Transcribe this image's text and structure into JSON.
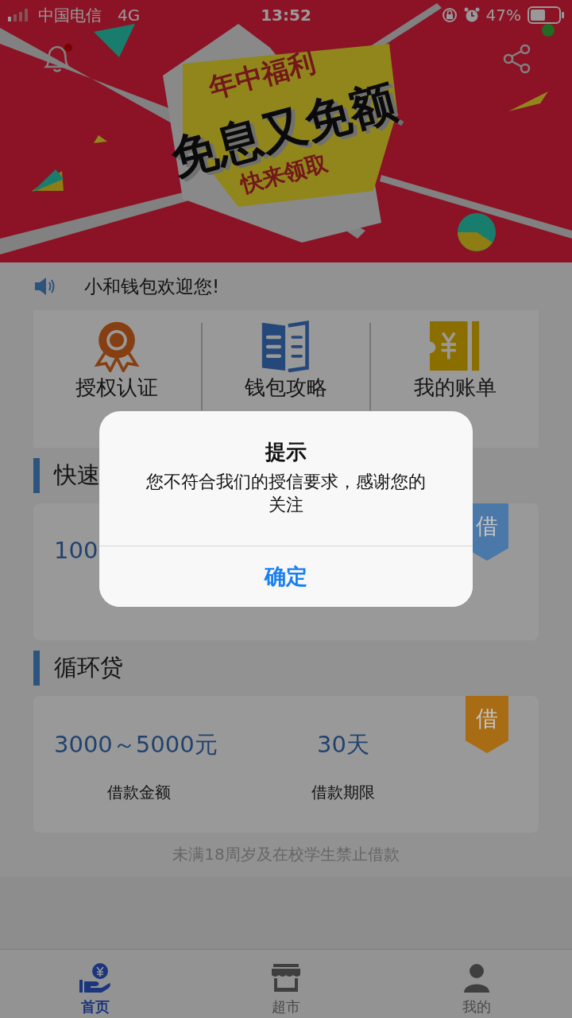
{
  "status_bar": {
    "carrier": "中国电信",
    "network": "4G",
    "time": "13:52",
    "battery": "47%"
  },
  "banner": {
    "tagline": "年中福利",
    "headline": "免息又免额",
    "subline": "快来领取"
  },
  "notice": "小和钱包欢迎您!",
  "shortcuts": [
    {
      "label": "授权认证",
      "kind": "medal"
    },
    {
      "label": "钱包攻略",
      "kind": "book"
    },
    {
      "label": "我的账单",
      "kind": "ticket"
    }
  ],
  "sections": [
    {
      "title": "快速",
      "badge": "借",
      "color": "#4a78a8",
      "fields": [
        {
          "value": "100"
        }
      ]
    },
    {
      "title": "循环贷",
      "badge": "借",
      "color": "#a86c14",
      "fields": [
        {
          "value": "3000～5000元",
          "label": "借款金额"
        },
        {
          "value": "30天",
          "label": "借款期限"
        }
      ]
    }
  ],
  "disclaimer": "未满18周岁及在校学生禁止借款",
  "tab_bar": [
    {
      "label": "首页",
      "kind": "home",
      "selected": true
    },
    {
      "label": "超市",
      "kind": "store",
      "selected": false
    },
    {
      "label": "我的",
      "kind": "profile",
      "selected": false
    }
  ],
  "dialog": {
    "title": "提示",
    "message": "您不符合我们的授信要求，感谢您的关注",
    "button": "确定"
  }
}
